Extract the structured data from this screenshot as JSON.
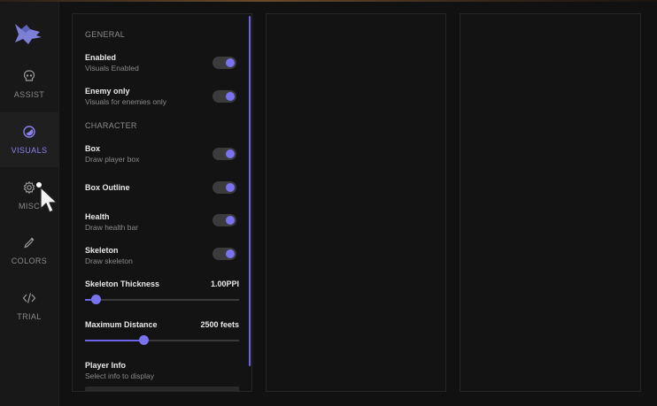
{
  "sidebar": {
    "logo_icon": "wolf-logo-icon",
    "items": [
      {
        "label": "ASSIST",
        "icon": "skull-icon",
        "active": false
      },
      {
        "label": "VISUALS",
        "icon": "visuals-circle-icon",
        "active": true
      },
      {
        "label": "MISC",
        "icon": "gear-icon",
        "active": false
      },
      {
        "label": "COLORS",
        "icon": "eyedropper-icon",
        "active": false
      },
      {
        "label": "TRIAL",
        "icon": "code-icon",
        "active": false
      }
    ]
  },
  "panel": {
    "general_header": "GENERAL",
    "enabled": {
      "title": "Enabled",
      "desc": "Visuals Enabled",
      "on": true
    },
    "enemy_only": {
      "title": "Enemy only",
      "desc": "Visuals for enemies only",
      "on": true
    },
    "character_header": "CHARACTER",
    "box": {
      "title": "Box",
      "desc": "Draw player box",
      "on": true
    },
    "box_outline": {
      "title": "Box Outline",
      "on": true
    },
    "health": {
      "title": "Health",
      "desc": "Draw health bar",
      "on": true
    },
    "skeleton": {
      "title": "Skeleton",
      "desc": "Draw skeleton",
      "on": true
    },
    "skeleton_thickness": {
      "title": "Skeleton Thickness",
      "value": "1.00PPI",
      "fraction": 0.07
    },
    "max_distance": {
      "title": "Maximum Distance",
      "value": "2500 feets",
      "fraction": 0.38
    },
    "player_info": {
      "title": "Player Info",
      "desc": "Select info to display"
    }
  },
  "colors": {
    "accent": "#7a73f0",
    "background": "#111111"
  }
}
